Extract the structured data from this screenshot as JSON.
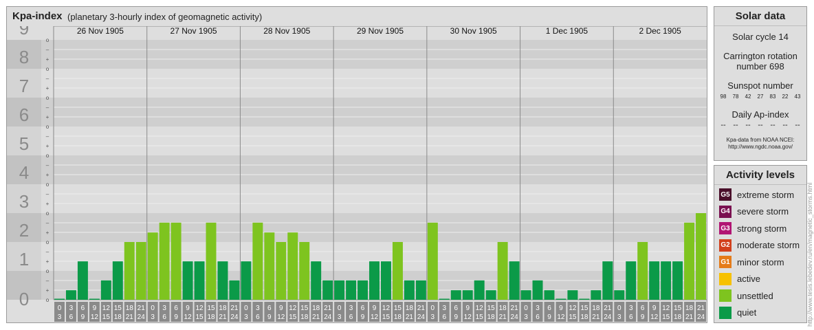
{
  "header": {
    "title": "Kpa-index",
    "subtitle": "(planetary 3-hourly index of geomagnetic activity)"
  },
  "chart_data": {
    "type": "bar",
    "ylim": [
      0,
      9
    ],
    "y_ticks": [
      "0",
      "1",
      "2",
      "3",
      "4",
      "5",
      "6",
      "7",
      "8",
      "9"
    ],
    "minor_marks": [
      "–",
      "o",
      "+"
    ],
    "days": [
      "26 Nov 1905",
      "27 Nov 1905",
      "28 Nov 1905",
      "29 Nov 1905",
      "30 Nov 1905",
      "1 Dec 1905",
      "2 Dec 1905"
    ],
    "interval_start": [
      "0",
      "3",
      "6",
      "9",
      "12",
      "15",
      "18",
      "21"
    ],
    "interval_end": [
      "3",
      "6",
      "9",
      "12",
      "15",
      "18",
      "21",
      "24"
    ],
    "values": [
      [
        0,
        0.33,
        1.33,
        0,
        0.67,
        1.33,
        2,
        2
      ],
      [
        2.33,
        2.67,
        2.67,
        1.33,
        1.33,
        2.67,
        1.33,
        0.67
      ],
      [
        1.33,
        2.67,
        2.33,
        2,
        2.33,
        2,
        1.33,
        0.67
      ],
      [
        0.67,
        0.67,
        0.67,
        1.33,
        1.33,
        2,
        0.67,
        0.67
      ],
      [
        2.67,
        0,
        0.33,
        0.33,
        0.67,
        0.33,
        2,
        1.33
      ],
      [
        0.33,
        0.67,
        0.33,
        0,
        0.33,
        0,
        0.33,
        1.33
      ],
      [
        0.33,
        1.33,
        2,
        1.33,
        1.33,
        1.33,
        2.67,
        3
      ]
    ],
    "colors": {
      "quiet": "#0b9a48",
      "unsettled": "#7ec41f"
    }
  },
  "solar": {
    "title": "Solar data",
    "cycle": "Solar cycle 14",
    "carrington_line1": "Carrington rotation",
    "carrington_line2": "number 698",
    "sunspot_title": "Sunspot number",
    "sunspots": [
      "98",
      "78",
      "42",
      "27",
      "83",
      "22",
      "43"
    ],
    "ap_title": "Daily Ap-index",
    "ap_values": [
      "--",
      "--",
      "--",
      "--",
      "--",
      "--",
      "--"
    ],
    "source_line1": "Kpa-data from NOAA NCEI:",
    "source_line2": "http://www.ngdc.noaa.gov/"
  },
  "levels": {
    "title": "Activity levels",
    "items": [
      {
        "code": "G5",
        "label": "extreme storm",
        "color": "#4a0f2a"
      },
      {
        "code": "G4",
        "label": "severe storm",
        "color": "#7a1050"
      },
      {
        "code": "G3",
        "label": "strong storm",
        "color": "#b11573"
      },
      {
        "code": "G2",
        "label": "moderate storm",
        "color": "#d2401c"
      },
      {
        "code": "G1",
        "label": "minor storm",
        "color": "#e57b18"
      },
      {
        "code": "",
        "label": "active",
        "color": "#f7c100"
      },
      {
        "code": "",
        "label": "unsettled",
        "color": "#7ec41f"
      },
      {
        "code": "",
        "label": "quiet",
        "color": "#0b9a48"
      }
    ]
  },
  "watermark": "http://www.tesis.lebedev.ru/en/magnetic_storms.html"
}
